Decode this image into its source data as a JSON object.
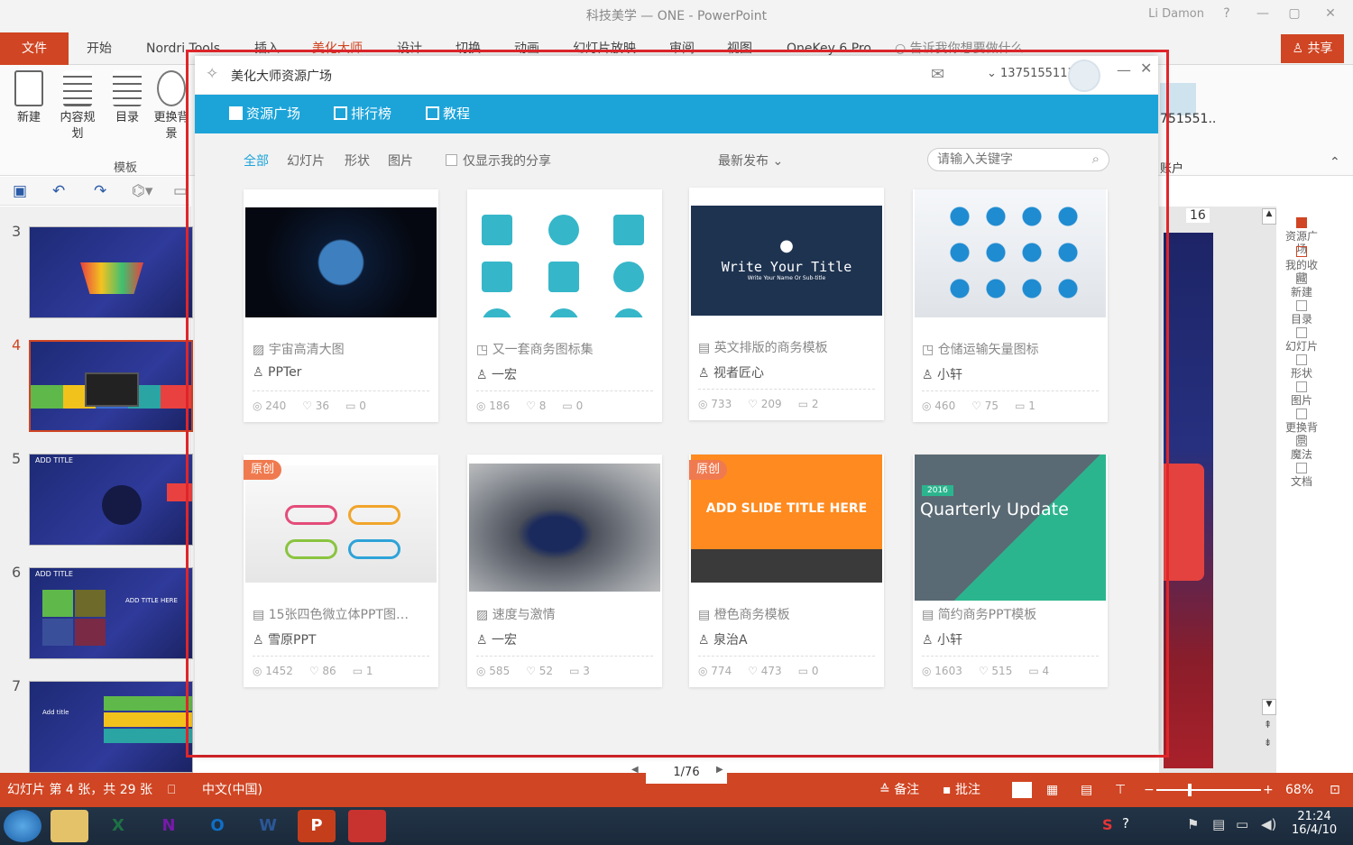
{
  "window": {
    "title": "科技美学 — ONE - PowerPoint",
    "user": "Li Damon",
    "minimize": "—",
    "restore": "▢",
    "close": "✕"
  },
  "ribbon": {
    "file": "文件",
    "tabs": [
      "开始",
      "Nordri Tools",
      "插入",
      "美化大师",
      "设计",
      "切换",
      "动画",
      "幻灯片放映",
      "审阅",
      "视图",
      "OneKey 6 Pro"
    ],
    "tell_me": "告诉我你想要做什么",
    "share": "共享",
    "buttons": [
      "新建",
      "内容规划",
      "目录",
      "更换背景"
    ],
    "group_label": "模板",
    "account_label": "账户",
    "account_id": "751551..",
    "page_indicator": "16"
  },
  "slides": {
    "numbers": [
      "3",
      "4",
      "5",
      "6",
      "7"
    ],
    "labels_5": "ADD TITLE",
    "labels_6": "ADD TITLE",
    "label_6b": "ADD TITLE HERE",
    "label_7": "Add title"
  },
  "side_tools": [
    "资源广场",
    "我的收藏",
    "新建",
    "目录",
    "幻灯片",
    "形状",
    "图片",
    "更换背景",
    "魔法",
    "文档"
  ],
  "status": {
    "slide_info": "幻灯片 第 4 张，共 29 张",
    "lang": "中文(中国)",
    "notes": "备注",
    "comments": "批注",
    "zoom": "68%"
  },
  "taskbar": {
    "time": "21:24",
    "date": "16/4/10",
    "apps": [
      "X",
      "N",
      "O",
      "W",
      "P"
    ]
  },
  "dialog": {
    "title": "美化大师资源广场",
    "account": "1375155113",
    "nav": [
      "资源广场",
      "排行榜",
      "教程"
    ],
    "filters": [
      "全部",
      "幻灯片",
      "形状",
      "图片"
    ],
    "only_mine": "仅显示我的分享",
    "sort": "最新发布",
    "search_placeholder": "请输入关键字",
    "cards": [
      {
        "title": "宇宙高清大图",
        "author": "PPTer",
        "views": "240",
        "likes": "36",
        "comments": "0"
      },
      {
        "title": "又一套商务图标集",
        "author": "一宏",
        "views": "186",
        "likes": "8",
        "comments": "0"
      },
      {
        "title": "英文排版的商务模板",
        "author": "视者匠心",
        "views": "733",
        "likes": "209",
        "comments": "2",
        "thumb_text": "Write Your Title",
        "thumb_sub": "Write Your Name Or Sub-title"
      },
      {
        "title": "仓储运输矢量图标",
        "author": "小轩",
        "views": "460",
        "likes": "75",
        "comments": "1"
      },
      {
        "title": "15张四色微立体PPT图…",
        "author": "雪原PPT",
        "views": "1452",
        "likes": "86",
        "comments": "1",
        "badge": "原创"
      },
      {
        "title": "速度与激情",
        "author": "一宏",
        "views": "585",
        "likes": "52",
        "comments": "3"
      },
      {
        "title": "橙色商务模板",
        "author": "泉治A",
        "views": "774",
        "likes": "473",
        "comments": "0",
        "badge": "原创",
        "thumb_text": "ADD SLIDE TITLE HERE"
      },
      {
        "title": "简约商务PPT模板",
        "author": "小轩",
        "views": "1603",
        "likes": "515",
        "comments": "4",
        "thumb_text": "Quarterly Update",
        "thumb_tag": "2016"
      }
    ],
    "pager": "1/76"
  }
}
